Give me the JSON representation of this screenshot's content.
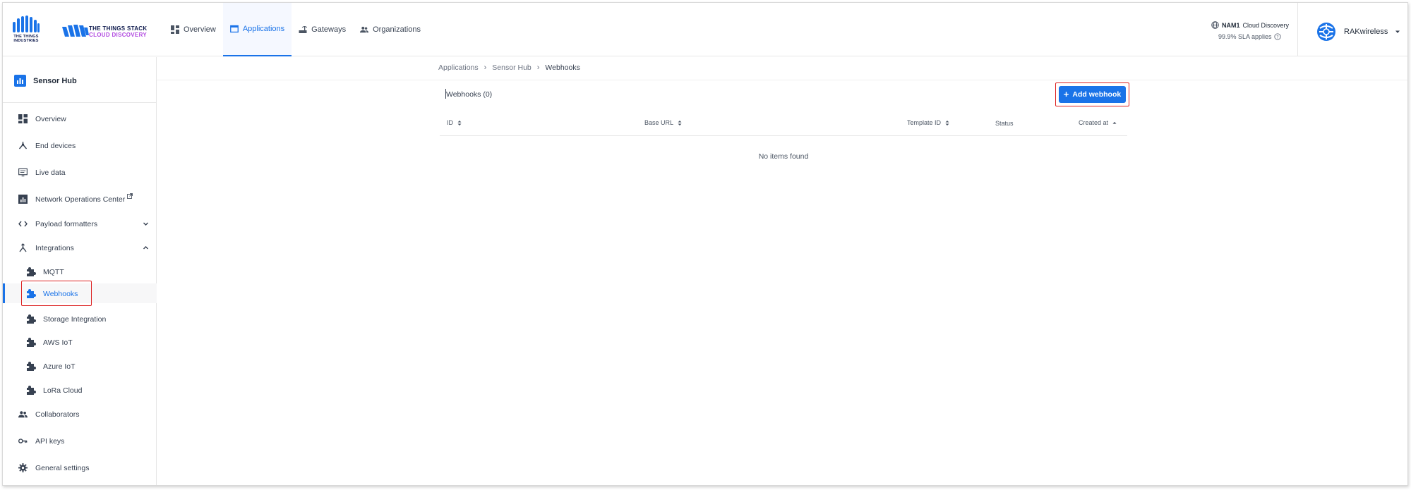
{
  "brand": {
    "tti_logo_text": "THE THINGS INDUSTRIES",
    "product_line1": "THE THINGS STACK",
    "product_line2": "CLOUD DISCOVERY",
    "primary_color": "#1a73e8",
    "accent_color": "#b14ae0"
  },
  "nav": {
    "items": [
      {
        "label": "Overview",
        "icon": "dashboard-icon"
      },
      {
        "label": "Applications",
        "icon": "application-icon",
        "active": true
      },
      {
        "label": "Gateways",
        "icon": "gateway-icon"
      },
      {
        "label": "Organizations",
        "icon": "organization-icon"
      }
    ]
  },
  "cluster": {
    "region": "NAM1",
    "name": "Cloud Discovery",
    "sla": "99.9% SLA applies"
  },
  "user": {
    "name": "RAKwireless"
  },
  "sidebar": {
    "app_name": "Sensor Hub",
    "items": [
      {
        "label": "Overview",
        "icon": "dashboard-icon"
      },
      {
        "label": "End devices",
        "icon": "devices-icon"
      },
      {
        "label": "Live data",
        "icon": "live-data-icon"
      },
      {
        "label": "Network Operations Center",
        "icon": "chart-icon"
      },
      {
        "label": "Payload formatters",
        "icon": "code-icon"
      },
      {
        "label": "Integrations",
        "icon": "merge-icon"
      }
    ],
    "integrations": [
      {
        "label": "MQTT"
      },
      {
        "label": "Webhooks",
        "active": true
      },
      {
        "label": "Storage Integration"
      },
      {
        "label": "AWS IoT"
      },
      {
        "label": "Azure IoT"
      },
      {
        "label": "LoRa Cloud"
      }
    ],
    "bottom_items": [
      {
        "label": "Collaborators",
        "icon": "people-icon"
      },
      {
        "label": "API keys",
        "icon": "key-icon"
      },
      {
        "label": "General settings",
        "icon": "gear-icon"
      }
    ]
  },
  "breadcrumb": [
    "Applications",
    "Sensor Hub",
    "Webhooks"
  ],
  "list": {
    "title": "Webhooks (0)",
    "add_label": "Add webhook",
    "columns": [
      "ID",
      "Base URL",
      "Template ID",
      "Status",
      "Created at"
    ],
    "empty_text": "No items found"
  }
}
